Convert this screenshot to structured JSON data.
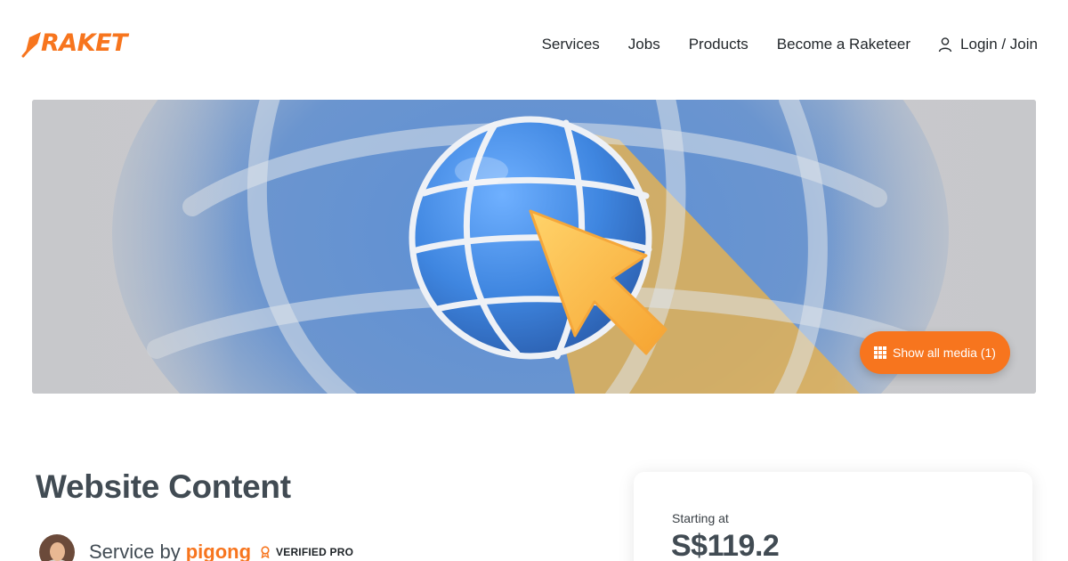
{
  "brand": {
    "name": "RAKET",
    "color": "#f7751e"
  },
  "nav": {
    "items": [
      {
        "label": "Services"
      },
      {
        "label": "Jobs"
      },
      {
        "label": "Products"
      },
      {
        "label": "Become a Raketeer"
      }
    ],
    "login_label": "Login / Join"
  },
  "hero": {
    "show_media_label": "Show all media (1)",
    "icons": [
      "globe-icon",
      "cursor-arrow-icon"
    ]
  },
  "service": {
    "title": "Website Content",
    "by_label": "Service by",
    "seller": "pigong",
    "badge_label": "VERIFIED PRO"
  },
  "pricing": {
    "starting_label": "Starting at",
    "price": "S$119.2"
  },
  "colors": {
    "accent": "#f7751e",
    "heading": "#414b53",
    "globe_blue": "#4a8fe0",
    "cursor_yellow": "#fbb848"
  }
}
